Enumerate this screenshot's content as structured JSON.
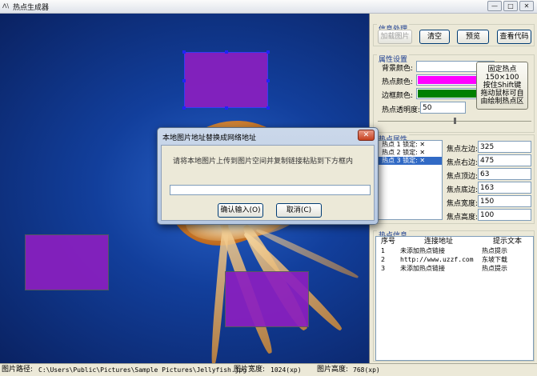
{
  "window": {
    "title": "热点生成器",
    "app_icon": "app-logo-icon",
    "controls": [
      "—",
      "□",
      "✕"
    ]
  },
  "info_group": {
    "title": "信息处理",
    "load_image": "加载图片",
    "clear": "清空",
    "preview": "预览",
    "view_code": "查看代码"
  },
  "props_group": {
    "title": "属性设置",
    "bg_color_label": "背景颜色:",
    "hot_color_label": "热点颜色:",
    "border_color_label": "边框颜色:",
    "opacity_label": "热点透明度:",
    "opacity_value": "50",
    "colors": {
      "background": "#ffffff",
      "hotspot": "#ff00ff",
      "border": "#008000"
    },
    "fix_button_lines": [
      "固定热点",
      "150×100",
      "按住Shift键",
      "拖动鼠标可自",
      "由绘制热点区"
    ]
  },
  "hotspot_props": {
    "title": "热点属性",
    "list": [
      "热点 1 锁定: ✕",
      "热点 2 锁定: ✕",
      "热点 3 锁定: ✕"
    ],
    "selected_index": 2,
    "left_label": "焦点左边:",
    "left": "325",
    "right_label": "焦点右边:",
    "right": "475",
    "top_label": "焦点顶边:",
    "top": "63",
    "bottom_label": "焦点底边:",
    "bottom": "163",
    "width_label": "焦点宽度:",
    "width": "150",
    "height_label": "焦点高度:",
    "height": "100"
  },
  "hotspot_info": {
    "title": "热点信息",
    "columns": [
      "序号",
      "连接地址",
      "提示文本"
    ],
    "rows": [
      [
        "1",
        "未添加热点链接",
        "热点提示"
      ],
      [
        "2",
        "http://www.uzzf.com",
        "东坡下载"
      ],
      [
        "3",
        "未添加热点链接",
        "热点提示"
      ]
    ]
  },
  "dialog": {
    "title": "本地图片地址替换成网络地址",
    "close": "✕",
    "message": "请将本地图片上传到图片空间并复制链接粘贴到下方框内",
    "input_value": "",
    "ok": "确认输入(O)",
    "cancel": "取消(C)"
  },
  "status": {
    "path_label": "图片路径:",
    "path_value": "C:\\Users\\Public\\Pictures\\Sample Pictures\\Jellyfish.jpg",
    "width_label": "图片宽度:",
    "width_value": "1024(xp)",
    "height_label": "图片高度:",
    "height_value": "768(xp)"
  }
}
